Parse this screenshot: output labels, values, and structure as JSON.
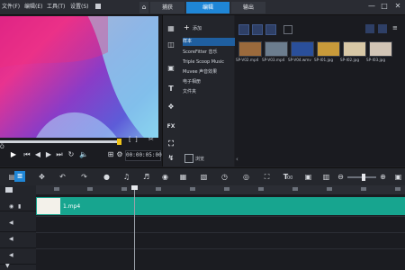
{
  "menu": [
    "文件(F)",
    "编辑(E)",
    "工具(T)",
    "设置(S)"
  ],
  "tabs": [
    {
      "label": "捕获",
      "active": false
    },
    {
      "label": "编辑",
      "active": true
    },
    {
      "label": "输出",
      "active": false
    }
  ],
  "window_controls": [
    "—",
    "□",
    "✕"
  ],
  "preview": {
    "timecode": "00:00:05:00",
    "left_label": "Ö",
    "range_labels": [
      "[",
      "]"
    ]
  },
  "library": {
    "add_label": "添加",
    "folders": [
      {
        "label": "样本",
        "selected": true
      },
      {
        "label": "ScoreFitter 音乐",
        "selected": false
      },
      {
        "label": "Triple Scoop Music",
        "selected": false
      },
      {
        "label": "Muvee 声音效果",
        "selected": false
      },
      {
        "label": "电子相册",
        "selected": false
      },
      {
        "label": "文件夹",
        "selected": false
      }
    ],
    "browse_label": "浏览",
    "tool_labels": [
      "FX"
    ],
    "media": [
      {
        "name": "SP-V02.mp4",
        "color": "#9b6a3c"
      },
      {
        "name": "SP-V03.mp4",
        "color": "#6c7d8e"
      },
      {
        "name": "SP-V04.wmv",
        "color": "#2a4f9a"
      },
      {
        "name": "SP-I01.jpg",
        "color": "#c89a3a"
      },
      {
        "name": "SP-I02.jpg",
        "color": "#d8c8a6"
      },
      {
        "name": "SP-I03.jpg",
        "color": "#d2c5b6"
      }
    ]
  },
  "timeline": {
    "clip_name": "1.mp4",
    "zoom_level": 0.55,
    "text_tool_label": "T",
    "text_tool_suffix": "00"
  },
  "colors": {
    "accent": "#1f86d6",
    "clip": "#17a58f",
    "scrub_handle": "#f0c419"
  }
}
